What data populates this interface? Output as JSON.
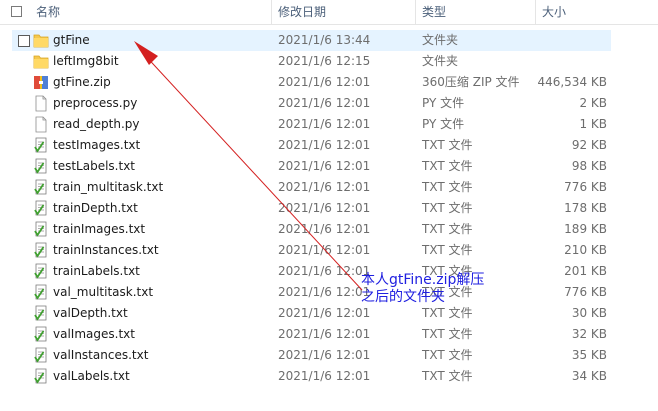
{
  "header": {
    "name": "名称",
    "date": "修改日期",
    "type": "类型",
    "size": "大小",
    "sort_arrow": "^"
  },
  "files": [
    {
      "name": "gtFine",
      "date": "2021/1/6 13:44",
      "type": "文件夹",
      "size": "",
      "icon": "folder-icon",
      "selected": true
    },
    {
      "name": "leftImg8bit",
      "date": "2021/1/6 12:15",
      "type": "文件夹",
      "size": "",
      "icon": "folder-icon"
    },
    {
      "name": "gtFine.zip",
      "date": "2021/1/6 12:01",
      "type": "360压缩 ZIP 文件",
      "size": "446,534 KB",
      "icon": "zip-archive-icon"
    },
    {
      "name": "preprocess.py",
      "date": "2021/1/6 12:01",
      "type": "PY 文件",
      "size": "2 KB",
      "icon": "file-icon"
    },
    {
      "name": "read_depth.py",
      "date": "2021/1/6 12:01",
      "type": "PY 文件",
      "size": "1 KB",
      "icon": "file-icon"
    },
    {
      "name": "testImages.txt",
      "date": "2021/1/6 12:01",
      "type": "TXT 文件",
      "size": "92 KB",
      "icon": "text-file-icon"
    },
    {
      "name": "testLabels.txt",
      "date": "2021/1/6 12:01",
      "type": "TXT 文件",
      "size": "98 KB",
      "icon": "text-file-icon"
    },
    {
      "name": "train_multitask.txt",
      "date": "2021/1/6 12:01",
      "type": "TXT 文件",
      "size": "776 KB",
      "icon": "text-file-icon"
    },
    {
      "name": "trainDepth.txt",
      "date": "2021/1/6 12:01",
      "type": "TXT 文件",
      "size": "178 KB",
      "icon": "text-file-icon"
    },
    {
      "name": "trainImages.txt",
      "date": "2021/1/6 12:01",
      "type": "TXT 文件",
      "size": "189 KB",
      "icon": "text-file-icon"
    },
    {
      "name": "trainInstances.txt",
      "date": "2021/1/6 12:01",
      "type": "TXT 文件",
      "size": "210 KB",
      "icon": "text-file-icon"
    },
    {
      "name": "trainLabels.txt",
      "date": "2021/1/6 12:01",
      "type": "TXT 文件",
      "size": "201 KB",
      "icon": "text-file-icon"
    },
    {
      "name": "val_multitask.txt",
      "date": "2021/1/6 12:01",
      "type": "TXT 文件",
      "size": "776 KB",
      "icon": "text-file-icon"
    },
    {
      "name": "valDepth.txt",
      "date": "2021/1/6 12:01",
      "type": "TXT 文件",
      "size": "30 KB",
      "icon": "text-file-icon"
    },
    {
      "name": "valImages.txt",
      "date": "2021/1/6 12:01",
      "type": "TXT 文件",
      "size": "32 KB",
      "icon": "text-file-icon"
    },
    {
      "name": "valInstances.txt",
      "date": "2021/1/6 12:01",
      "type": "TXT 文件",
      "size": "35 KB",
      "icon": "text-file-icon"
    },
    {
      "name": "valLabels.txt",
      "date": "2021/1/6 12:01",
      "type": "TXT 文件",
      "size": "34 KB",
      "icon": "text-file-icon"
    }
  ],
  "annotation": {
    "line1": "本人gtFine.zip解压",
    "line2": "之后的文件夹",
    "color": "#2020e0",
    "arrow_color": "#d42020"
  }
}
